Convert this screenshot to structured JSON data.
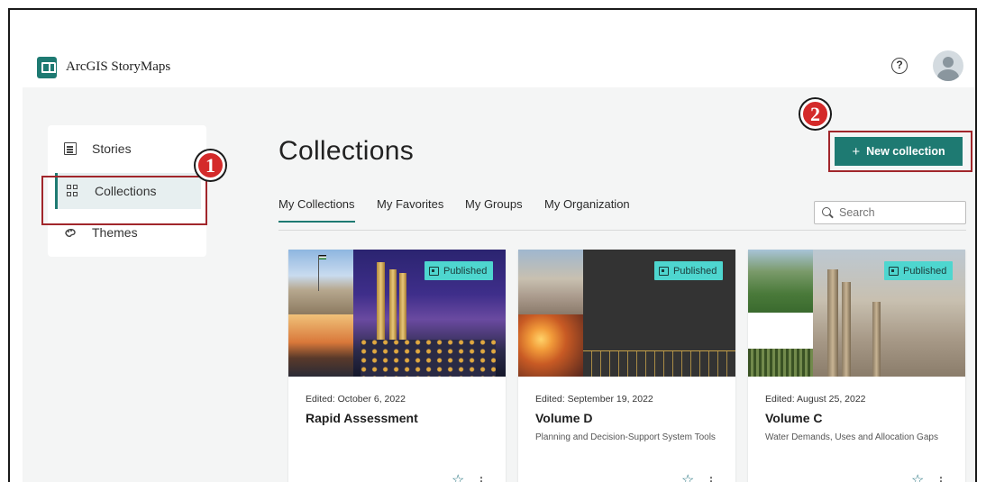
{
  "app": {
    "name": "ArcGIS StoryMaps",
    "logo_icon": "storymaps-logo-icon",
    "accent": "#1e7a72"
  },
  "header": {
    "help_icon": "?",
    "avatar_icon": "user-avatar-icon"
  },
  "sidebar": {
    "items": [
      {
        "label": "Stories",
        "icon": "document-icon",
        "active": false
      },
      {
        "label": "Collections",
        "icon": "grid-icon",
        "active": true
      },
      {
        "label": "Themes",
        "icon": "palette-icon",
        "active": false
      }
    ]
  },
  "annotations": {
    "step1": "1",
    "step2": "2"
  },
  "main": {
    "title": "Collections",
    "new_button": {
      "icon": "+",
      "label": "New collection"
    },
    "tabs": [
      {
        "label": "My Collections",
        "active": true
      },
      {
        "label": "My Favorites",
        "active": false
      },
      {
        "label": "My Groups",
        "active": false
      },
      {
        "label": "My Organization",
        "active": false
      }
    ],
    "search": {
      "placeholder": "Search"
    }
  },
  "cards": [
    {
      "status": "Published",
      "edited": "Edited: October 6, 2022",
      "title": "Rapid Assessment",
      "description": "",
      "star": "☆",
      "more": "⋮"
    },
    {
      "status": "Published",
      "edited": "Edited: September 19, 2022",
      "title": "Volume D",
      "description": "Planning and Decision-Support System Tools",
      "star": "☆",
      "more": "⋮"
    },
    {
      "status": "Published",
      "edited": "Edited: August 25, 2022",
      "title": "Volume C",
      "description": "Water Demands, Uses and Allocation Gaps",
      "star": "☆",
      "more": "⋮"
    }
  ]
}
